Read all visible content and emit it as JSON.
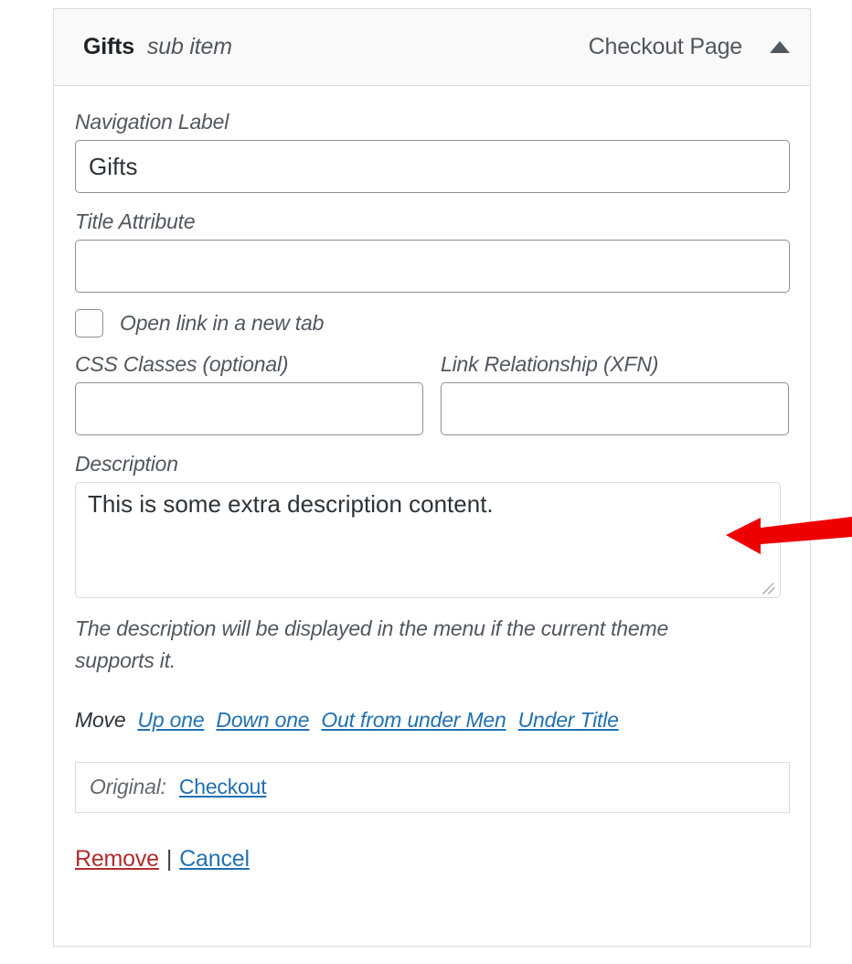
{
  "panel": {
    "header": {
      "title": "Gifts",
      "subtitle": "sub item",
      "item_type": "Checkout Page",
      "toggle_icon": "chevron-up-icon"
    },
    "fields": {
      "navigation_label": {
        "label": "Navigation Label",
        "value": "Gifts",
        "placeholder": ""
      },
      "title_attribute": {
        "label": "Title Attribute",
        "value": "",
        "placeholder": ""
      },
      "new_tab": {
        "label": "Open link in a new tab",
        "checked": false
      },
      "css_classes": {
        "label": "CSS Classes (optional)",
        "value": "",
        "placeholder": ""
      },
      "link_relationship": {
        "label": "Link Relationship (XFN)",
        "value": "",
        "placeholder": ""
      },
      "description": {
        "label": "Description",
        "value": "This is some extra description content.",
        "placeholder": "",
        "help": "The description will be displayed in the menu if the current theme supports it."
      }
    },
    "move": {
      "label": "Move",
      "links": [
        {
          "label": "Up one"
        },
        {
          "label": "Down one"
        },
        {
          "label": "Out from under Men"
        },
        {
          "label": "Under Title"
        }
      ]
    },
    "original": {
      "label": "Original:",
      "link": "Checkout"
    },
    "actions": {
      "remove": "Remove",
      "separator": "|",
      "cancel": "Cancel"
    }
  },
  "annotation": {
    "arrow_icon": "arrow-left-icon",
    "color": "#ee0000"
  },
  "colors": {
    "link": "#2271b1",
    "danger": "#b32d2e",
    "text": "#2c3338",
    "muted": "#50575e",
    "border": "#8c8f94",
    "panel_border": "#dcdcde",
    "header_bg": "#f9f9f9"
  }
}
